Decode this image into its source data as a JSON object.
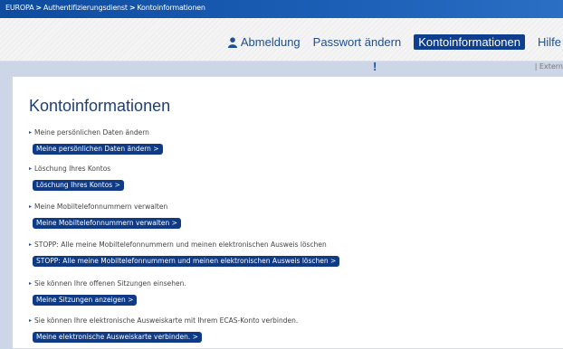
{
  "breadcrumb": {
    "items": [
      "EUROPA",
      "Authentifizierungsdienst",
      "Kontoinformationen"
    ],
    "separator": ">"
  },
  "nav": {
    "logout": "Abmeldung",
    "change_password": "Passwort ändern",
    "account_info": "Kontoinformationen",
    "help": "Hilfe",
    "alert": "!",
    "extern": "| Extern"
  },
  "page": {
    "title": "Kontoinformationen"
  },
  "sections": [
    {
      "desc": "Meine persönlichen Daten ändern",
      "button": "Meine persönlichen Daten ändern >"
    },
    {
      "desc": "Löschung Ihres Kontos",
      "button": "Löschung Ihres Kontos >"
    },
    {
      "desc": "Meine Mobiltelefonnummern verwalten",
      "button": "Meine Mobiltelefonnummern verwalten >"
    },
    {
      "desc": "STOPP: Alle meine Mobiltelefonnummern und meinen elektronischen Ausweis löschen",
      "button": "STOPP: Alle meine Mobiltelefonnummern und meinen elektronischen Ausweis löschen >"
    },
    {
      "desc": "Sie können Ihre offenen Sitzungen einsehen.",
      "button": "Meine Sitzungen anzeigen >"
    },
    {
      "desc": "Sie können Ihre elektronische Ausweiskarte mit Ihrem ECAS-Konto verbinden.",
      "button": "Meine elektronische Ausweiskarte verbinden. >"
    }
  ],
  "colors": {
    "topbar": "#0e4c9f",
    "link": "#1f4e95",
    "button_bg": "#0e3a86",
    "title": "#1c3f78"
  }
}
